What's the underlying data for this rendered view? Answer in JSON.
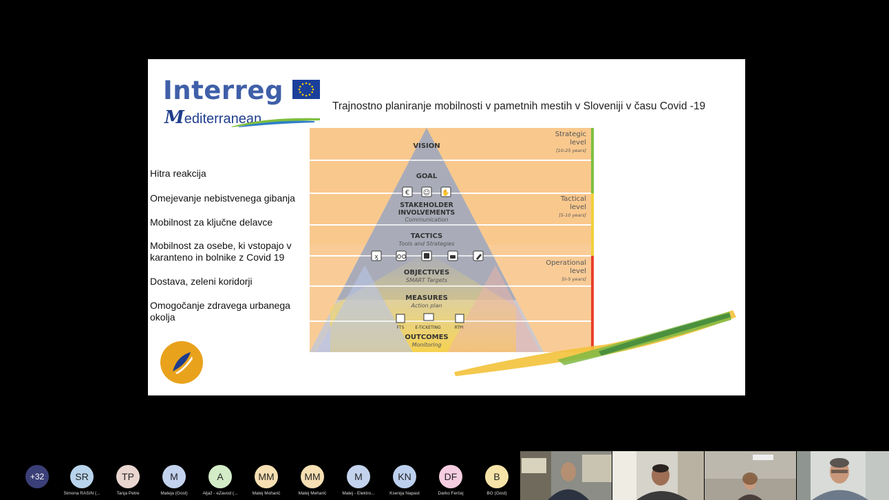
{
  "slide": {
    "logo": {
      "interreg": "Interreg",
      "mediterranean_m": "M",
      "mediterranean_rest": "editerranean"
    },
    "title": "Trajnostno planiranje mobilnosti v pametnih mestih v Sloveniji v času Covid -19",
    "bullets": [
      "Hitra reakcija",
      "Omejevanje nebistvenega gibanja",
      "Mobilnost za ključne delavce",
      "Mobilnost za osebe, ki vstopajo v karanteno in bolnike z Covid 19",
      "Dostava, zeleni koridorji",
      "Omogočanje zdravega urbanega okolja"
    ],
    "pyramid": {
      "levels": [
        {
          "title": "VISION",
          "sub": ""
        },
        {
          "title": "GOAL",
          "sub": ""
        },
        {
          "title": "STAKEHOLDER INVOLVEMENTS",
          "sub": "Communication"
        },
        {
          "title": "TACTICS",
          "sub": "Tools and Strategies"
        },
        {
          "title": "OBJECTIVES",
          "sub": "SMART Targets"
        },
        {
          "title": "MEASURES",
          "sub": "Action plan"
        },
        {
          "title": "OUTCOMES",
          "sub": "Monitoring"
        }
      ],
      "side_labels": [
        {
          "line1": "Strategic",
          "line2": "level",
          "years": "[10-25 years]",
          "color": "#7fbf3f"
        },
        {
          "line1": "Tactical",
          "line2": "level",
          "years": "[5-10 years]",
          "color": "#f2d03b"
        },
        {
          "line1": "Operational",
          "line2": "level",
          "years": "[0-5 years]",
          "color": "#e8412c"
        }
      ],
      "measure_icons": [
        "FTS",
        "E-TICKETING",
        "RTPI"
      ]
    }
  },
  "participants": {
    "more_count": "+32",
    "list": [
      {
        "initials": "SR",
        "name": "Simona RASIN (...",
        "color": "#b8d4ec"
      },
      {
        "initials": "TP",
        "name": "Tanja Petre",
        "color": "#ead6d0"
      },
      {
        "initials": "M",
        "name": "Mateja (Gost)",
        "color": "#c3d3ee"
      },
      {
        "initials": "A",
        "name": "Aljaž - eZavod (...",
        "color": "#d3ecc7"
      },
      {
        "initials": "MM",
        "name": "Matej Moharić",
        "color": "#f6dfb2"
      },
      {
        "initials": "MM",
        "name": "Matej Meharić",
        "color": "#f6dfb2"
      },
      {
        "initials": "M",
        "name": "Matej - Elektro...",
        "color": "#c3d3ee"
      },
      {
        "initials": "KN",
        "name": "Ksenija Napast",
        "color": "#bccfed"
      },
      {
        "initials": "DF",
        "name": "Darko Ferčej",
        "color": "#f5cde0"
      },
      {
        "initials": "B",
        "name": "BG (Gost)",
        "color": "#f6e3a8"
      }
    ]
  },
  "colors": {
    "background": "#000000",
    "pyramid_band": "#f9c88d",
    "pyramid_grey": "#aab0bd"
  }
}
